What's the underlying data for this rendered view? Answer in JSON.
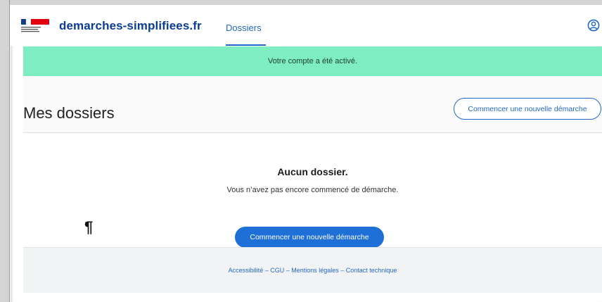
{
  "header": {
    "brand": "demarches-simplifiees.fr",
    "nav_tab": "Dossiers",
    "account_icon": "user-circle-icon"
  },
  "flash": {
    "message": "Votre compte a été activé."
  },
  "main": {
    "title": "Mes dossiers",
    "new_procedure_button": "Commencer une nouvelle démarche",
    "empty_title": "Aucun dossier.",
    "empty_text": "Vous n’avez pas encore commencé de démarche.",
    "pilcrow": "¶",
    "primary_button": "Commencer une nouvelle démarche"
  },
  "footer": {
    "links": [
      "Accessibilité",
      "CGU",
      "Mentions légales",
      "Contact technique"
    ],
    "separator": " – "
  },
  "colors": {
    "brand": "#0a3d96",
    "accent": "#2268c9",
    "flash_bg": "#7eedc2",
    "primary_button": "#1e6fd6"
  }
}
